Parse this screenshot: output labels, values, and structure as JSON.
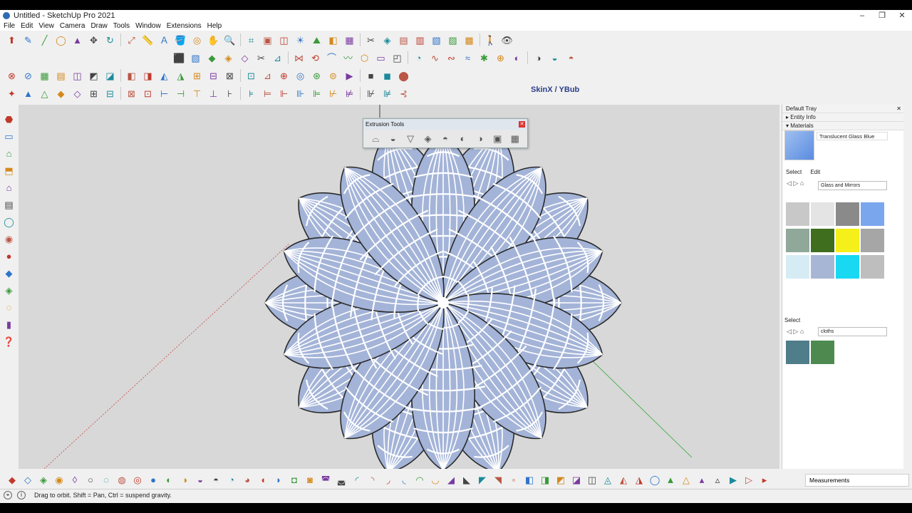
{
  "window": {
    "title": "Untitled - SketchUp Pro 2021",
    "minimize": "–",
    "maximize": "❐",
    "close": "✕"
  },
  "menu": [
    "File",
    "Edit",
    "View",
    "Camera",
    "Draw",
    "Tools",
    "Window",
    "Extensions",
    "Help"
  ],
  "toolbar_rows": {
    "row1": [
      "select",
      "eraser",
      "line",
      "circle",
      "push-pull",
      "move",
      "rotate",
      "scale",
      "tape-measure",
      "text",
      "paint-bucket",
      "orbit",
      "pan",
      "zoom",
      "zoom-extents",
      "component",
      "layer",
      "shadow",
      "sandbox",
      "style",
      "solid-tools",
      "section",
      "view-iso",
      "view-top",
      "view-front",
      "view-right",
      "view-back",
      "view-left",
      "walk",
      "look-around"
    ],
    "row2": [
      "follow-me",
      "offset",
      "intersect",
      "outer-shell",
      "union",
      "subtract",
      "trim",
      "split",
      "flip",
      "arc",
      "freehand",
      "polygon",
      "rectangle",
      "rotated-rect",
      "pie",
      "curve",
      "bezier",
      "spline",
      "explode",
      "weld",
      "hide-edges",
      "soften",
      "smooth",
      "select-ring"
    ],
    "row3": [
      "solid-inspector",
      "fix",
      "lattice",
      "quad",
      "round-corner",
      "fillet",
      "chamfer",
      "align",
      "distribute",
      "mirror",
      "array",
      "cleanup",
      "label",
      "tag",
      "dimension",
      "protractor",
      "axes",
      "section-plane",
      "section-fill",
      "ruby-console",
      "scene",
      "camera-view",
      "layout",
      "export"
    ],
    "row4": [
      "vertex-tools",
      "face-select",
      "edge-select",
      "group",
      "component-edit",
      "outliner",
      "frame",
      "grid",
      "curviloft",
      "bezier-spline",
      "skinx-ybub",
      "polyline",
      "arcs",
      "circle",
      "ellipse",
      "wave",
      "spiral",
      "helix",
      "spline",
      "sketch",
      "trim",
      "cut",
      "extend",
      "fillet"
    ]
  },
  "toolbar_icons": {
    "row1": [
      "⬆",
      "✎",
      "╱",
      "◯",
      "▲",
      "✥",
      "↻",
      "⤢",
      "📏",
      "Ａ",
      "🪣",
      "◎",
      "✋",
      "🔍",
      "⌗",
      "▣",
      "◫",
      "☀",
      "⛰",
      "◧",
      "▦",
      "✂",
      "◈",
      "▤",
      "▥",
      "▧",
      "▨",
      "▩",
      "🚶",
      "👁"
    ],
    "row2": [
      "⬛",
      "▧",
      "◆",
      "◈",
      "◇",
      "✂",
      "⊿",
      "⋈",
      "⟲",
      "⌒",
      "〰",
      "⬡",
      "▭",
      "◰",
      "◔",
      "∿",
      "∾",
      "≈",
      "✱",
      "⊕",
      "◐",
      "◑",
      "◒",
      "◓"
    ],
    "row3": [
      "⊗",
      "⊘",
      "▦",
      "▤",
      "◫",
      "◩",
      "◪",
      "◧",
      "◨",
      "◭",
      "◮",
      "⊞",
      "⊟",
      "⊠",
      "⊡",
      "⊿",
      "⊕",
      "◎",
      "⊛",
      "⊜",
      "▶",
      "■",
      "◼",
      "⬤"
    ],
    "row4": [
      "✦",
      "▲",
      "△",
      "◆",
      "◇",
      "⊞",
      "⊟",
      "⊠",
      "⊡",
      "⊢",
      "⊣",
      "⊤",
      "⊥",
      "⊦",
      "⊧",
      "⊨",
      "⊩",
      "⊪",
      "⊫",
      "⊬",
      "⊭",
      "⊮",
      "⊯",
      "⊰"
    ]
  },
  "left_toolbar_icons": [
    "⬣",
    "▭",
    "⌂",
    "⬒",
    "⌂",
    "▤",
    "◯",
    "◉",
    "●",
    "◆",
    "◈",
    "◌",
    "▮",
    "❓"
  ],
  "extrusion_tools": {
    "title": "Extrusion Tools",
    "icons": [
      "⌓",
      "◒",
      "▽",
      "◈",
      "◓",
      "◐",
      "◑",
      "▣",
      "▦"
    ]
  },
  "skinx_label": "SkinX / YBub",
  "tray": {
    "title": "Default Tray",
    "entity_info": "Entity Info",
    "materials": "Materials",
    "current_material": "Translucent Glass Blue",
    "tabs": [
      "Select",
      "Edit"
    ],
    "library": "Glass and Mirrors",
    "swatch_colors": [
      "#c8c8c8",
      "#e4e4e4",
      "#8a8a8a",
      "#7aa6ee",
      "#8fa89a",
      "#3e6e1e",
      "#f5f01a",
      "#a6a6a6",
      "#d6ecf5",
      "#a8b6d6",
      "#19d8f2",
      "#bebebe"
    ],
    "select2_label": "Select",
    "library2": "cloths",
    "swatch2_colors": [
      "#4f7d8a",
      "#4e8a50"
    ]
  },
  "bottom_toolbar_icons": [
    "◆",
    "◇",
    "◈",
    "◉",
    "◊",
    "○",
    "◌",
    "◍",
    "◎",
    "●",
    "◐",
    "◑",
    "◒",
    "◓",
    "◔",
    "◕",
    "◖",
    "◗",
    "◘",
    "◙",
    "◚",
    "◛",
    "◜",
    "◝",
    "◞",
    "◟",
    "◠",
    "◡",
    "◢",
    "◣",
    "◤",
    "◥",
    "◦",
    "◧",
    "◨",
    "◩",
    "◪",
    "◫",
    "◬",
    "◭",
    "◮",
    "◯",
    "▲",
    "△",
    "▴",
    "▵",
    "▶",
    "▷",
    "▸"
  ],
  "measurements_label": "Measurements",
  "status_text": "Drag to orbit. Shift = Pan, Ctrl = suspend gravity."
}
